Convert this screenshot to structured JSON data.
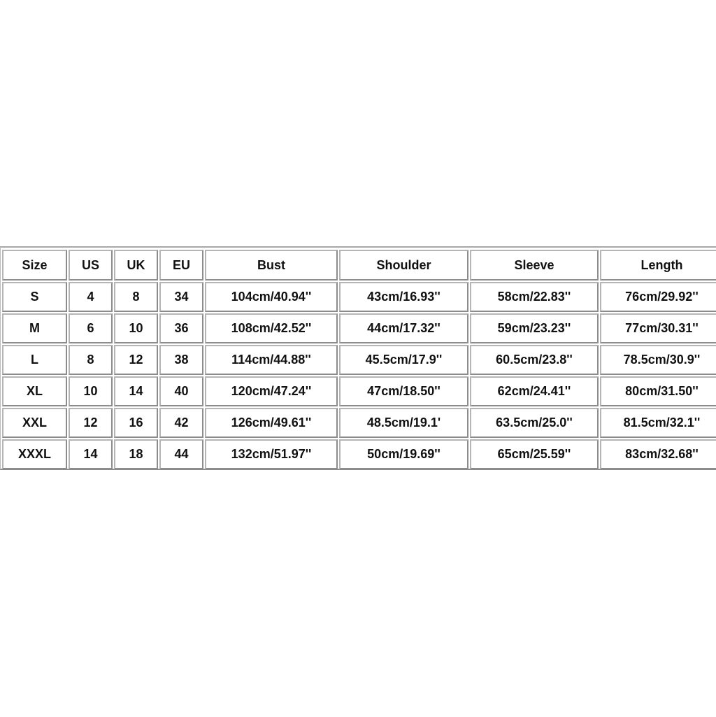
{
  "table": {
    "headers": [
      "Size",
      "US",
      "UK",
      "EU",
      "Bust",
      "Shoulder",
      "Sleeve",
      "Length"
    ],
    "rows": [
      [
        "S",
        "4",
        "8",
        "34",
        "104cm/40.94''",
        "43cm/16.93''",
        "58cm/22.83''",
        "76cm/29.92''"
      ],
      [
        "M",
        "6",
        "10",
        "36",
        "108cm/42.52''",
        "44cm/17.32''",
        "59cm/23.23''",
        "77cm/30.31''"
      ],
      [
        "L",
        "8",
        "12",
        "38",
        "114cm/44.88''",
        "45.5cm/17.9''",
        "60.5cm/23.8''",
        "78.5cm/30.9''"
      ],
      [
        "XL",
        "10",
        "14",
        "40",
        "120cm/47.24''",
        "47cm/18.50''",
        "62cm/24.41''",
        "80cm/31.50''"
      ],
      [
        "XXL",
        "12",
        "16",
        "42",
        "126cm/49.61''",
        "48.5cm/19.1'",
        "63.5cm/25.0''",
        "81.5cm/32.1''"
      ],
      [
        "XXXL",
        "14",
        "18",
        "44",
        "132cm/51.97''",
        "50cm/19.69''",
        "65cm/25.59''",
        "83cm/32.68''"
      ]
    ]
  }
}
